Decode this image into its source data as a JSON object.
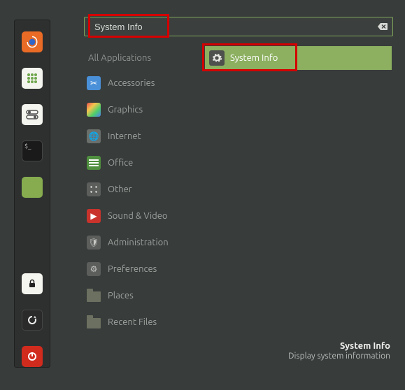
{
  "search": {
    "value": "System Info"
  },
  "categories": {
    "all_label": "All Applications",
    "items": [
      {
        "label": "Accessories"
      },
      {
        "label": "Graphics"
      },
      {
        "label": "Internet"
      },
      {
        "label": "Office"
      },
      {
        "label": "Other"
      },
      {
        "label": "Sound & Video"
      },
      {
        "label": "Administration"
      },
      {
        "label": "Preferences"
      },
      {
        "label": "Places"
      },
      {
        "label": "Recent Files"
      }
    ]
  },
  "results": [
    {
      "label": "System Info"
    }
  ],
  "footer": {
    "title": "System Info",
    "description": "Display system information"
  }
}
